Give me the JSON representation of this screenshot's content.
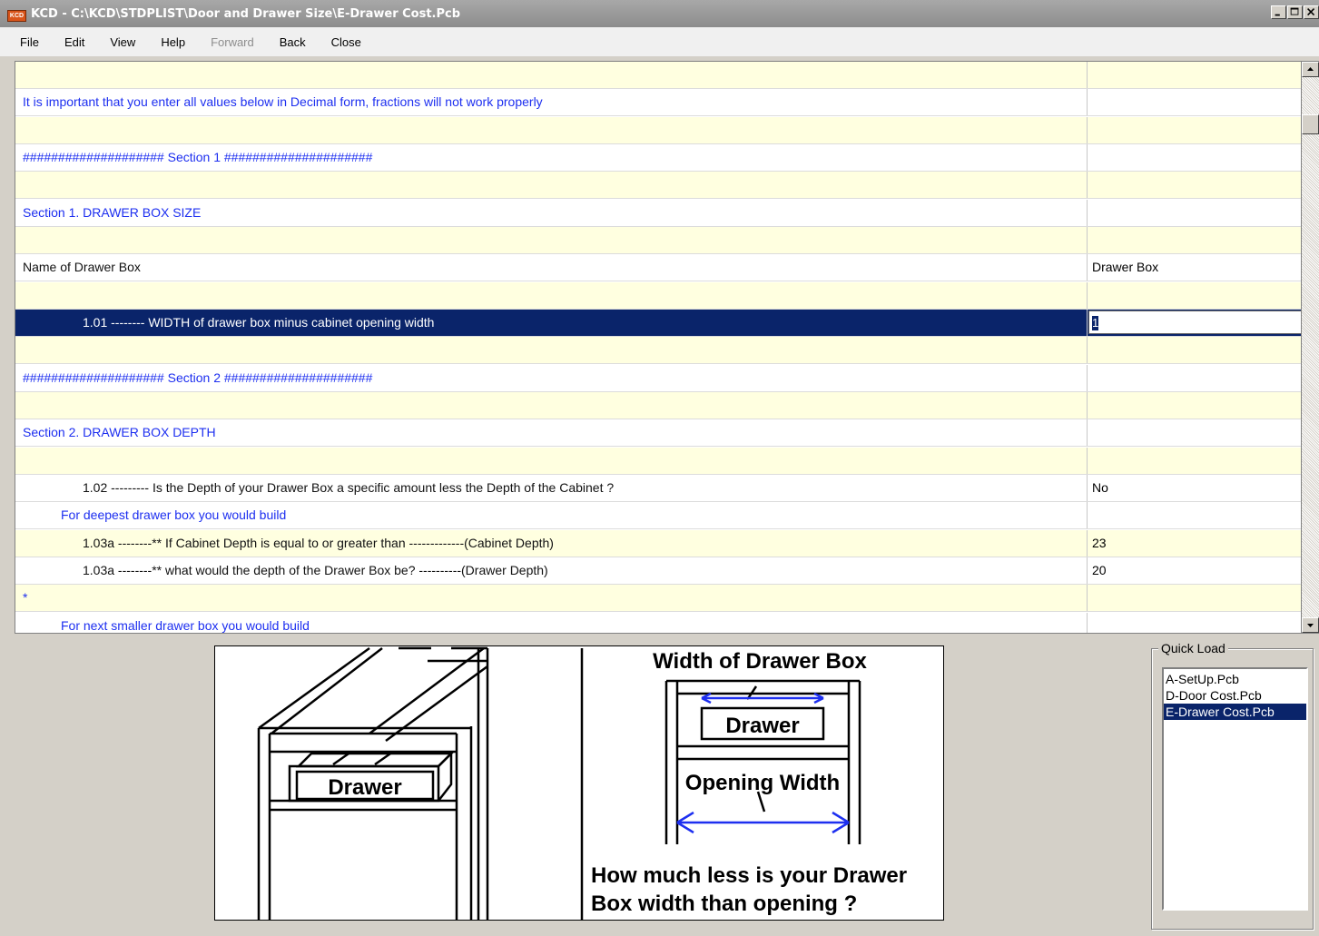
{
  "window": {
    "app_icon_text": "KCD",
    "title": "KCD  -  C:\\KCD\\STDPLIST\\Door and Drawer Size\\E-Drawer Cost.Pcb"
  },
  "menu": [
    "File",
    "Edit",
    "View",
    "Help",
    "Forward",
    "Back",
    "Close"
  ],
  "grid": {
    "rows": [
      {
        "label": "",
        "value": "",
        "style": "y",
        "color": "blue",
        "indent": 0
      },
      {
        "label": "It is important that you enter all values below in Decimal form, fractions will not work properly",
        "value": "",
        "style": "w",
        "color": "blue",
        "indent": 0
      },
      {
        "label": "",
        "value": "",
        "style": "y",
        "color": "blue",
        "indent": 0
      },
      {
        "label": "####################  Section 1  #####################",
        "value": "",
        "style": "w",
        "color": "blue",
        "indent": 0
      },
      {
        "label": "",
        "value": "",
        "style": "y",
        "color": "blue",
        "indent": 0
      },
      {
        "label": "Section 1.  DRAWER BOX SIZE",
        "value": "",
        "style": "w",
        "color": "blue",
        "indent": 0
      },
      {
        "label": "",
        "value": "",
        "style": "y",
        "color": "blue",
        "indent": 0
      },
      {
        "label": "Name of Drawer Box",
        "value": "Drawer Box",
        "style": "w",
        "color": "black",
        "indent": 0
      },
      {
        "label": "",
        "value": "",
        "style": "y",
        "color": "blue",
        "indent": 0
      },
      {
        "label": "1.01 -------- WIDTH of drawer box minus cabinet opening width",
        "value": "1",
        "style": "sel",
        "color": "black",
        "indent": 2
      },
      {
        "label": "",
        "value": "",
        "style": "y",
        "color": "blue",
        "indent": 0
      },
      {
        "label": "####################  Section 2  #####################",
        "value": "",
        "style": "w",
        "color": "blue",
        "indent": 0
      },
      {
        "label": "",
        "value": "",
        "style": "y",
        "color": "blue",
        "indent": 0
      },
      {
        "label": "Section 2.  DRAWER BOX DEPTH",
        "value": "",
        "style": "w",
        "color": "blue",
        "indent": 0
      },
      {
        "label": "",
        "value": "",
        "style": "y",
        "color": "blue",
        "indent": 0
      },
      {
        "label": "1.02 --------- Is the Depth of your Drawer Box a specific amount less the Depth of the Cabinet ?",
        "value": "No",
        "style": "w",
        "color": "black",
        "indent": 2
      },
      {
        "label": "For deepest drawer box you would build",
        "value": "",
        "style": "w",
        "color": "blue",
        "indent": 1
      },
      {
        "label": "1.03a --------** If Cabinet Depth is equal to or greater than -------------(Cabinet Depth)",
        "value": "23",
        "style": "y",
        "color": "black",
        "indent": 2
      },
      {
        "label": "1.03a --------** what would the depth of the Drawer Box be? ----------(Drawer Depth)",
        "value": "20",
        "style": "w",
        "color": "black",
        "indent": 2
      },
      {
        "label": "*",
        "value": "",
        "style": "y",
        "color": "blue",
        "indent": 0
      },
      {
        "label": "For next smaller drawer box you would build",
        "value": "",
        "style": "w",
        "color": "blue",
        "indent": 1
      }
    ]
  },
  "illustration": {
    "left_label": "Drawer",
    "right_title": "Width of Drawer Box",
    "right_drawer_label": "Drawer",
    "opening_label": "Opening Width",
    "question_line1": "How much less is your Drawer",
    "question_line2": "Box width than opening ?"
  },
  "quick_load": {
    "legend": "Quick Load",
    "items": [
      "A-SetUp.Pcb",
      "D-Door Cost.Pcb",
      "E-Drawer Cost.Pcb"
    ],
    "selected_index": 2
  }
}
